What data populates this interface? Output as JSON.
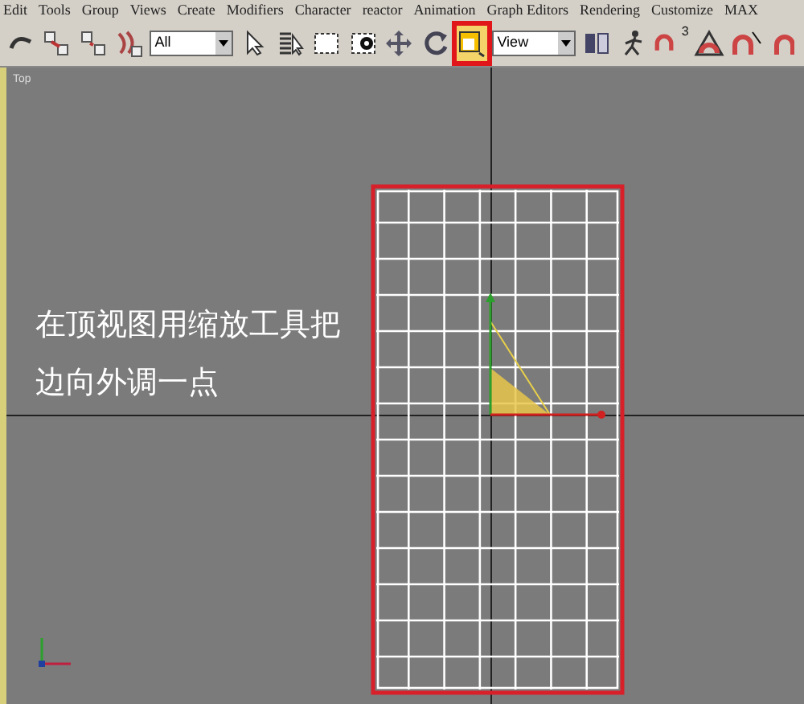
{
  "menu": [
    "Edit",
    "Tools",
    "Group",
    "Views",
    "Create",
    "Modifiers",
    "Character",
    "reactor",
    "Animation",
    "Graph Editors",
    "Rendering",
    "Customize",
    "MAX"
  ],
  "toolbar": [
    {
      "kind": "tool",
      "selected": false
    },
    {
      "kind": "tool",
      "selected": false
    },
    {
      "kind": "tool",
      "selected": false
    },
    {
      "kind": "tool",
      "selected": false
    },
    {
      "kind": "dropdown",
      "value": "All"
    },
    {
      "kind": "tool",
      "selected": false
    },
    {
      "kind": "tool",
      "selected": false
    },
    {
      "kind": "tool",
      "selected": false
    },
    {
      "kind": "tool",
      "selected": false
    },
    {
      "kind": "tool",
      "selected": false
    },
    {
      "kind": "tool",
      "selected": false
    },
    {
      "kind": "tool",
      "selected": true
    },
    {
      "kind": "dropdown",
      "value": "View"
    },
    {
      "kind": "tool",
      "selected": false
    },
    {
      "kind": "tool",
      "selected": false
    },
    {
      "kind": "tool",
      "selected": false,
      "label": "3"
    },
    {
      "kind": "tool",
      "selected": false
    },
    {
      "kind": "tool",
      "selected": false
    },
    {
      "kind": "tool",
      "selected": false
    }
  ],
  "viewport": {
    "label": "Top"
  },
  "annotation": [
    "在顶视图用缩放工具把",
    "边向外调一点"
  ]
}
